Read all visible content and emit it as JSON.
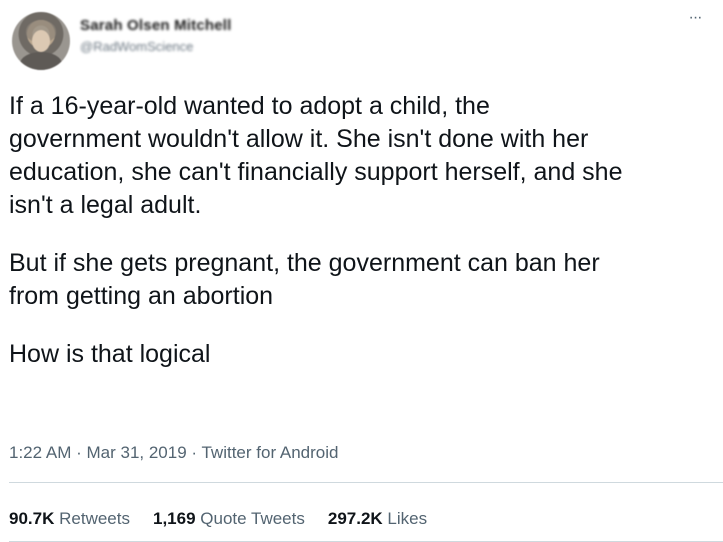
{
  "author": {
    "display_name": "Sarah Olsen Mitchell",
    "handle": "@RadWomScience"
  },
  "menu": {
    "more_label": "···"
  },
  "tweet": {
    "lines_p1": [
      "If a 16-year-old wanted to adopt a child, the",
      "government wouldn't allow it. She isn't done with her",
      "education, she can't financially support herself, and she",
      "isn't a legal adult."
    ],
    "lines_p2": [
      "But if she gets pregnant, the government can ban her",
      "from getting an abortion"
    ],
    "lines_p3": [
      "How is that logical"
    ]
  },
  "meta": {
    "time": "1:22 AM",
    "date": "Mar 31, 2019",
    "source": "Twitter for Android",
    "separator": " · "
  },
  "stats": {
    "retweets_count": "90.7K",
    "retweets_label": "Retweets",
    "quotes_count": "1,169",
    "quotes_label": "Quote Tweets",
    "likes_count": "297.2K",
    "likes_label": "Likes"
  }
}
